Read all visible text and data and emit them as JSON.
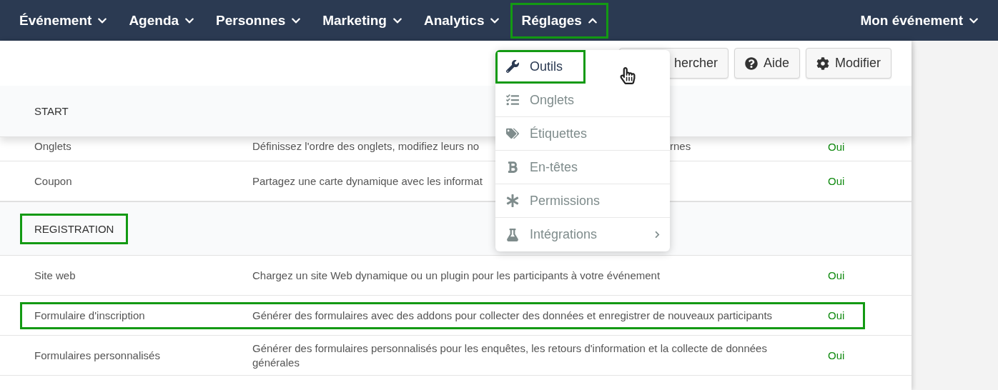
{
  "nav": {
    "items": [
      {
        "label": "Événement",
        "expanded": false,
        "highlighted": false
      },
      {
        "label": "Agenda",
        "expanded": false,
        "highlighted": false
      },
      {
        "label": "Personnes",
        "expanded": false,
        "highlighted": false
      },
      {
        "label": "Marketing",
        "expanded": false,
        "highlighted": false
      },
      {
        "label": "Analytics",
        "expanded": false,
        "highlighted": false
      },
      {
        "label": "Réglages",
        "expanded": true,
        "highlighted": true
      }
    ],
    "account": {
      "label": "Mon événement",
      "expanded": false
    }
  },
  "toolbar": {
    "buttons": [
      {
        "label": "hercher",
        "kind": "plain"
      },
      {
        "label": "Aide",
        "kind": "help"
      },
      {
        "label": "Modifier",
        "kind": "settings"
      }
    ]
  },
  "sections": [
    {
      "title": "START",
      "highlighted": false,
      "rows": [
        {
          "name": "Onglets",
          "description": "Définissez l'ordre des onglets, modifiez leurs no",
          "description_tail": "rnes",
          "value": "Oui",
          "highlighted": false
        },
        {
          "name": "Coupon",
          "description": "Partagez une carte dynamique avec les informat",
          "value": "Oui",
          "highlighted": false
        }
      ]
    },
    {
      "title": "REGISTRATION",
      "highlighted": true,
      "rows": [
        {
          "name": "Site web",
          "description": "Chargez un site Web dynamique ou un plugin pour les participants à votre événement",
          "value": "Oui",
          "highlighted": false
        },
        {
          "name": "Formulaire d'inscription",
          "description": "Générer des formulaires avec des addons pour collecter des données et enregistrer de nouveaux participants",
          "value": "Oui",
          "highlighted": true
        },
        {
          "name": "Formulaires personnalisés",
          "description": "Générer des formulaires personnalisés pour les enquêtes, les retours d'information et la collecte de données générales",
          "value": "Oui",
          "highlighted": false
        }
      ]
    }
  ],
  "menu": {
    "items": [
      {
        "label": "Outils",
        "kind": "wrench",
        "selected": true,
        "highlighted": true,
        "has_submenu": false
      },
      {
        "label": "Onglets",
        "kind": "checklist",
        "selected": false,
        "highlighted": false,
        "has_submenu": false
      },
      {
        "label": "Étiquettes",
        "kind": "tags",
        "selected": false,
        "highlighted": false,
        "has_submenu": false
      },
      {
        "label": "En-têtes",
        "kind": "bold",
        "selected": false,
        "highlighted": false,
        "has_submenu": false
      },
      {
        "label": "Permissions",
        "kind": "asterisk",
        "selected": false,
        "highlighted": false,
        "has_submenu": false
      },
      {
        "label": "Intégrations",
        "kind": "flask",
        "selected": false,
        "highlighted": false,
        "has_submenu": true
      }
    ]
  }
}
